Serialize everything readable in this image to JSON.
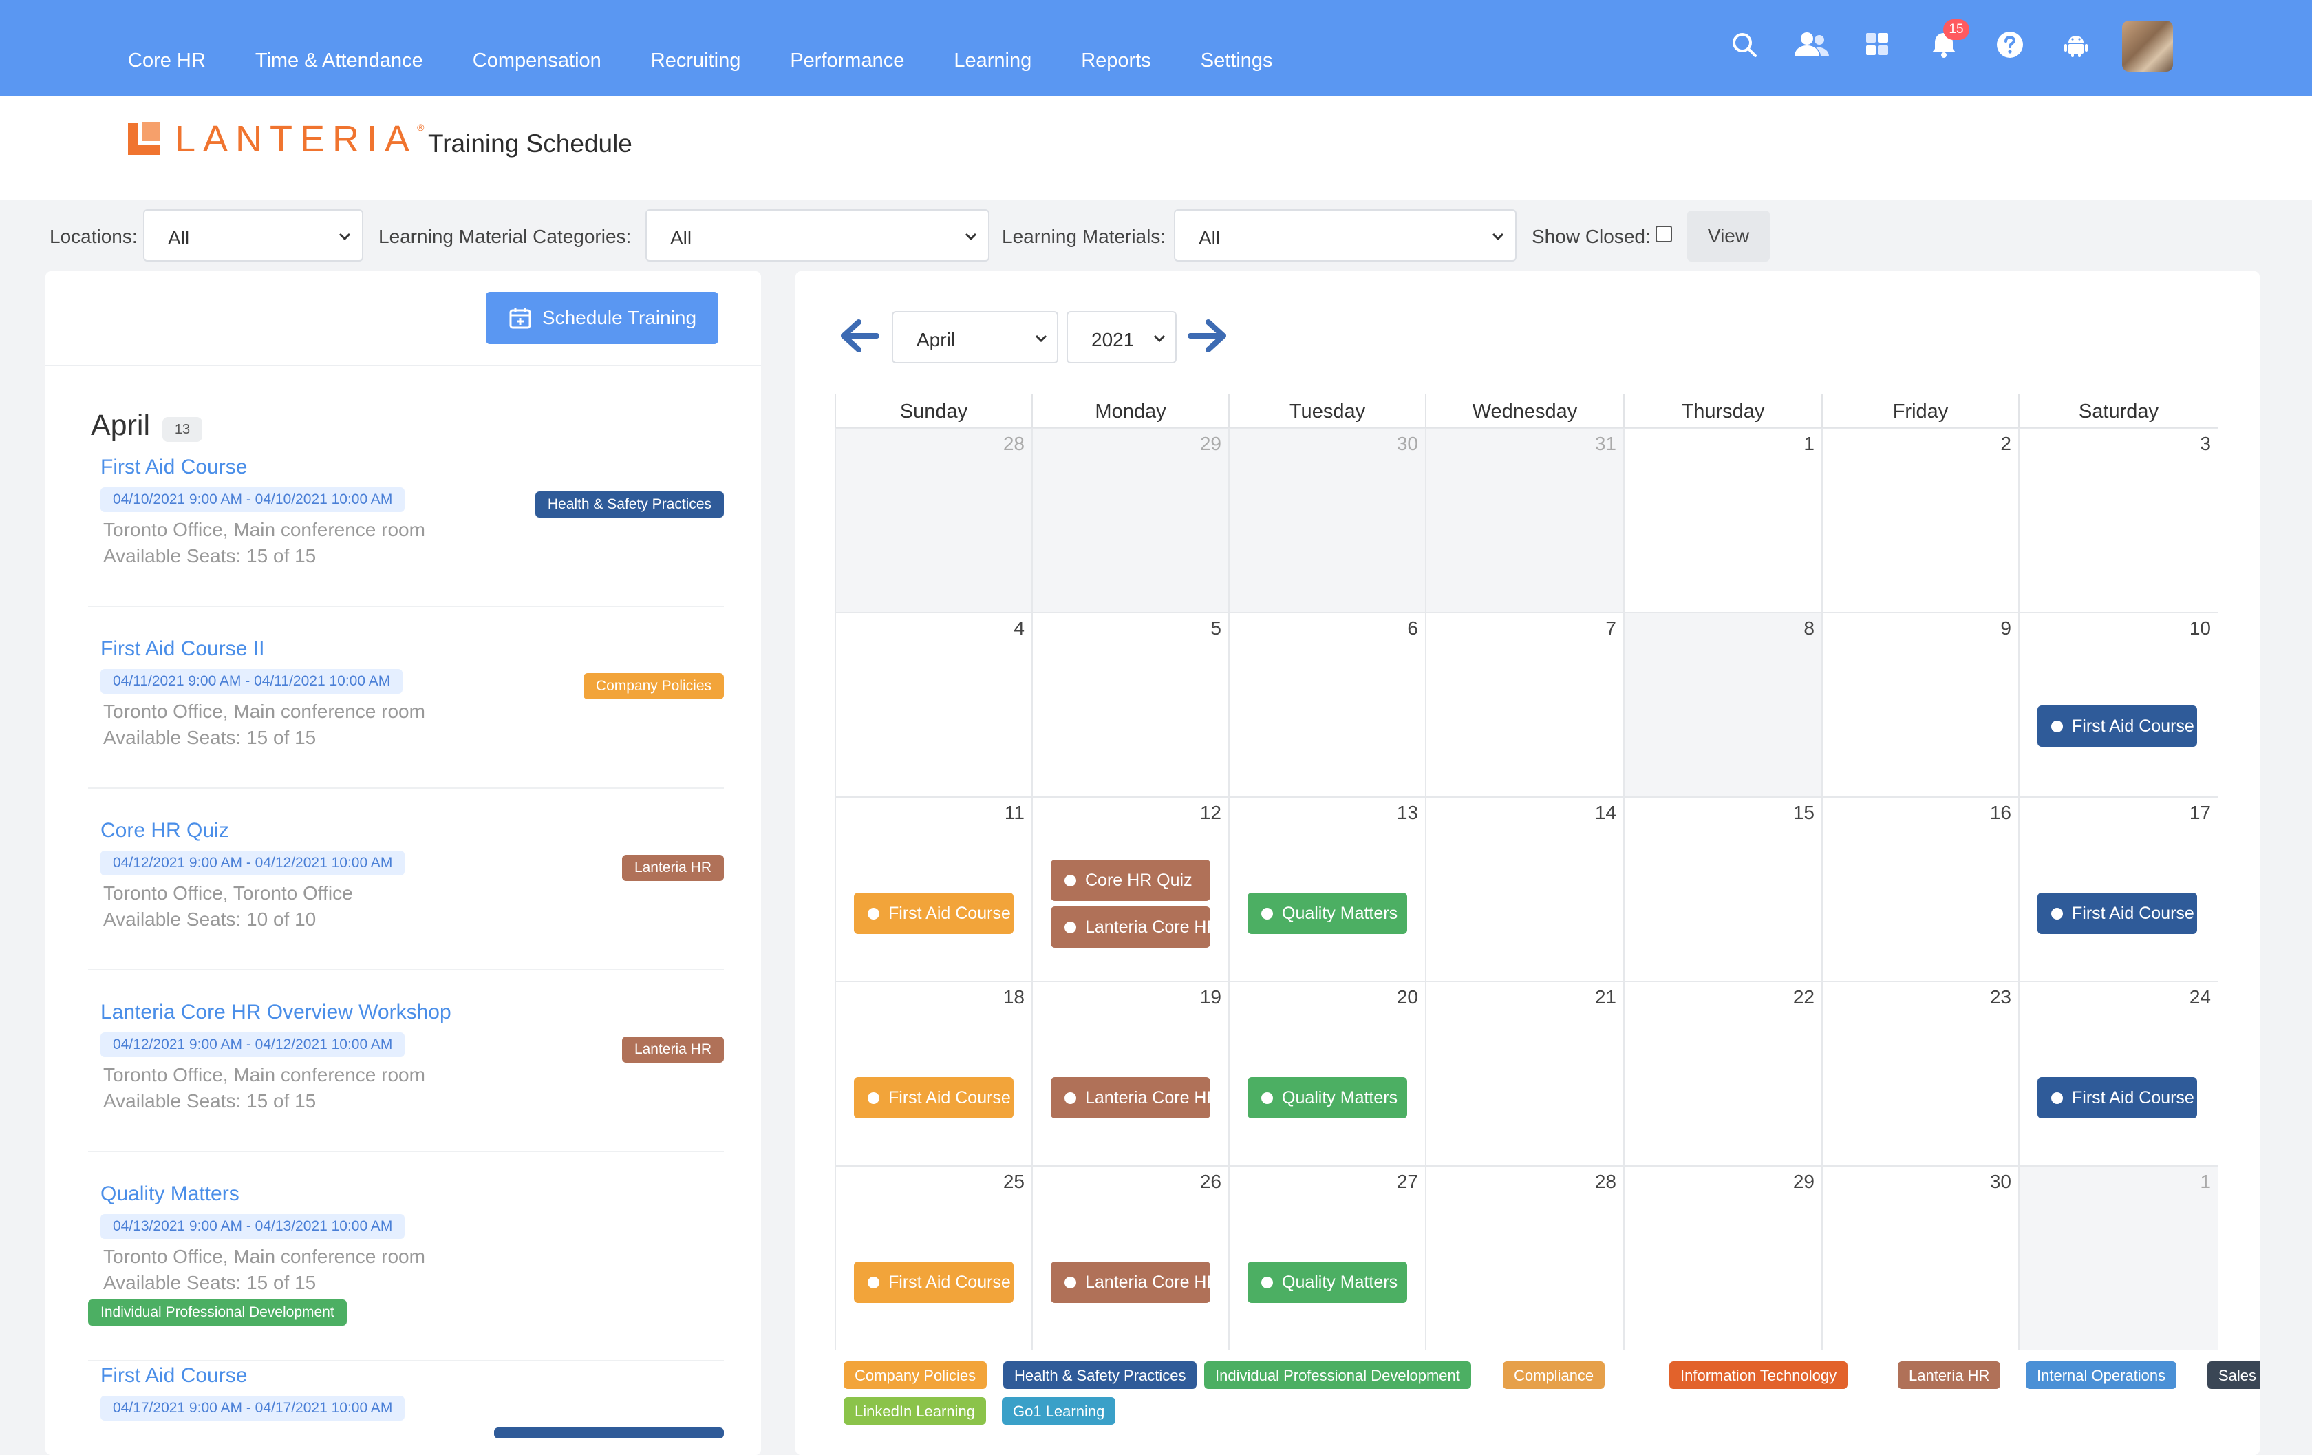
{
  "nav": {
    "items": [
      "Core HR",
      "Time & Attendance",
      "Compensation",
      "Recruiting",
      "Performance",
      "Learning",
      "Reports",
      "Settings"
    ],
    "notification_count": "15",
    "icons": [
      "search-icon",
      "people-icon",
      "apps-grid-icon",
      "bell-icon",
      "help-icon",
      "android-icon"
    ]
  },
  "header": {
    "logo_text": "LANTERIA",
    "logo_mark": "®",
    "page_title": "Training Schedule"
  },
  "filters": {
    "locations_label": "Locations:",
    "locations_value": "All",
    "categories_label": "Learning Material Categories:",
    "categories_value": "All",
    "materials_label": "Learning Materials:",
    "materials_value": "All",
    "show_closed_label": "Show Closed:",
    "view_label": "View"
  },
  "left": {
    "schedule_button": "Schedule Training",
    "month": "April",
    "month_count": "13",
    "courses": [
      {
        "title": "First Aid Course",
        "date": "04/10/2021 9:00 AM - 04/10/2021 10:00 AM",
        "location": "Toronto Office, Main conference room",
        "seats": "Available Seats: 15 of 15",
        "tag": "Health & Safety Practices",
        "tag_color": "#2f5b99"
      },
      {
        "title": "First Aid Course II",
        "date": "04/11/2021 9:00 AM - 04/11/2021 10:00 AM",
        "location": "Toronto Office, Main conference room",
        "seats": "Available Seats: 15 of 15",
        "tag": "Company Policies",
        "tag_color": "#f2a43a"
      },
      {
        "title": "Core HR Quiz",
        "date": "04/12/2021 9:00 AM - 04/12/2021 10:00 AM",
        "location": "Toronto Office, Toronto Office",
        "seats": "Available Seats: 10 of 10",
        "tag": "Lanteria HR",
        "tag_color": "#b07158"
      },
      {
        "title": "Lanteria Core HR Overview Workshop",
        "date": "04/12/2021 9:00 AM - 04/12/2021 10:00 AM",
        "location": "Toronto Office, Main conference room",
        "seats": "Available Seats: 15 of 15",
        "tag": "Lanteria HR",
        "tag_color": "#b07158"
      },
      {
        "title": "Quality Matters",
        "date": "04/13/2021 9:00 AM - 04/13/2021 10:00 AM",
        "location": "Toronto Office, Main conference room",
        "seats": "Available Seats: 15 of 15",
        "tag": "Individual Professional Development",
        "tag_color": "#4caf63"
      },
      {
        "title": "First Aid Course",
        "date": "04/17/2021 9:00 AM - 04/17/2021 10:00 AM",
        "location": "",
        "seats": "",
        "tag": "",
        "tag_color": "#2f5b99"
      }
    ]
  },
  "calendar": {
    "month_value": "April",
    "year_value": "2021",
    "weekdays": [
      "Sunday",
      "Monday",
      "Tuesday",
      "Wednesday",
      "Thursday",
      "Friday",
      "Saturday"
    ],
    "weeks": [
      [
        "28",
        "29",
        "30",
        "31",
        "1",
        "2",
        "3"
      ],
      [
        "4",
        "5",
        "6",
        "7",
        "8",
        "9",
        "10"
      ],
      [
        "11",
        "12",
        "13",
        "14",
        "15",
        "16",
        "17"
      ],
      [
        "18",
        "19",
        "20",
        "21",
        "22",
        "23",
        "24"
      ],
      [
        "25",
        "26",
        "27",
        "28",
        "29",
        "30",
        "1"
      ]
    ],
    "events": [
      {
        "week": 1,
        "day": 6,
        "slot": 0,
        "label": "First Aid Course",
        "color": "#2f5b99"
      },
      {
        "week": 2,
        "day": 0,
        "slot": 1,
        "label": "First Aid Course",
        "color": "#f2a43a"
      },
      {
        "week": 2,
        "day": 1,
        "slot": 0,
        "label": "Core HR Quiz",
        "color": "#b07158"
      },
      {
        "week": 2,
        "day": 1,
        "slot": 2,
        "label": "Lanteria Core HR",
        "color": "#b07158"
      },
      {
        "week": 2,
        "day": 2,
        "slot": 1,
        "label": "Quality Matters",
        "color": "#4caf63"
      },
      {
        "week": 2,
        "day": 6,
        "slot": 1,
        "label": "First Aid Course",
        "color": "#2f5b99"
      },
      {
        "week": 3,
        "day": 0,
        "slot": 1,
        "label": "First Aid Course",
        "color": "#f2a43a"
      },
      {
        "week": 3,
        "day": 1,
        "slot": 1,
        "label": "Lanteria Core HR",
        "color": "#b07158"
      },
      {
        "week": 3,
        "day": 2,
        "slot": 1,
        "label": "Quality Matters",
        "color": "#4caf63"
      },
      {
        "week": 3,
        "day": 6,
        "slot": 1,
        "label": "First Aid Course",
        "color": "#2f5b99"
      },
      {
        "week": 4,
        "day": 0,
        "slot": 1,
        "label": "First Aid Course",
        "color": "#f2a43a"
      },
      {
        "week": 4,
        "day": 1,
        "slot": 1,
        "label": "Lanteria Core HR",
        "color": "#b07158"
      },
      {
        "week": 4,
        "day": 2,
        "slot": 1,
        "label": "Quality Matters",
        "color": "#4caf63"
      }
    ],
    "legend": [
      {
        "label": "Company Policies",
        "color": "#f2a43a"
      },
      {
        "label": "Health & Safety Practices",
        "color": "#2f5b99"
      },
      {
        "label": "Individual Professional Development",
        "color": "#4caf63"
      },
      {
        "label": "Compliance",
        "color": "#e6a04a"
      },
      {
        "label": "Information Technology",
        "color": "#e2622b"
      },
      {
        "label": "Lanteria HR",
        "color": "#b07158"
      },
      {
        "label": "Internal Operations",
        "color": "#4a90d6"
      },
      {
        "label": "Sales",
        "color": "#3a4655"
      },
      {
        "label": "LinkedIn Learning",
        "color": "#8bc34a"
      },
      {
        "label": "Go1 Learning",
        "color": "#3aa0c8"
      }
    ]
  }
}
